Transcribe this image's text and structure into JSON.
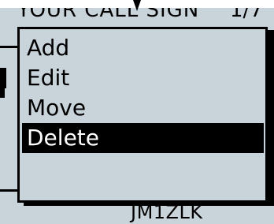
{
  "header": {
    "title": "YOUR CALL SIGN",
    "page": "1/7"
  },
  "menu": {
    "items": [
      {
        "label": "Add",
        "selected": false
      },
      {
        "label": "Edit",
        "selected": false
      },
      {
        "label": "Move",
        "selected": false
      },
      {
        "label": "Delete",
        "selected": true
      }
    ]
  },
  "footer": {
    "callsign": "JM1ZLK"
  },
  "colors": {
    "screen_background": "#c9d3da",
    "text": "#000000",
    "selection_background": "#000000",
    "selection_text": "#ffffff"
  },
  "icons": {
    "pointer": "down-arrow-pointer-icon"
  }
}
